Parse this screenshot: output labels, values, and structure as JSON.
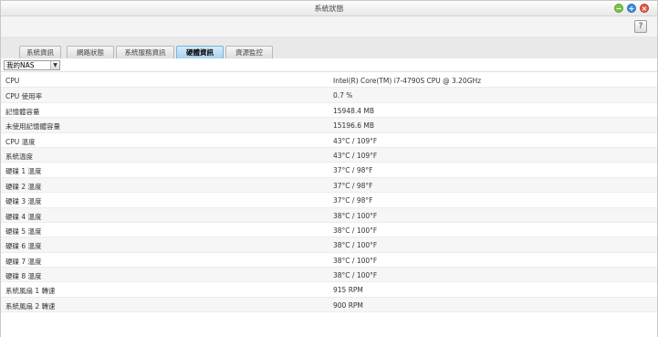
{
  "window": {
    "title": "系統狀態"
  },
  "tabs": [
    {
      "label": "系統資訊"
    },
    {
      "label": "網路狀態"
    },
    {
      "label": "系統服務資訊"
    },
    {
      "label": "硬體資訊",
      "active": true
    },
    {
      "label": "資源監控"
    }
  ],
  "help": {
    "label": "?"
  },
  "filter": {
    "selected": "我的NAS"
  },
  "rows": [
    {
      "key": "CPU",
      "value": "Intel(R) Core(TM) i7-4790S CPU @ 3.20GHz"
    },
    {
      "key": "CPU 使用率",
      "value": "0.7 %"
    },
    {
      "key": "記憶體容量",
      "value": "15948.4 MB"
    },
    {
      "key": "未使用記憶體容量",
      "value": "15196.6 MB"
    },
    {
      "key": "CPU 溫度",
      "value": "43°C / 109°F"
    },
    {
      "key": "系統溫度",
      "value": "43°C / 109°F"
    },
    {
      "key": "硬碟 1 溫度",
      "value": "37°C / 98°F"
    },
    {
      "key": "硬碟 2 溫度",
      "value": "37°C / 98°F"
    },
    {
      "key": "硬碟 3 溫度",
      "value": "37°C / 98°F"
    },
    {
      "key": "硬碟 4 溫度",
      "value": "38°C / 100°F"
    },
    {
      "key": "硬碟 5 溫度",
      "value": "38°C / 100°F"
    },
    {
      "key": "硬碟 6 溫度",
      "value": "38°C / 100°F"
    },
    {
      "key": "硬碟 7 溫度",
      "value": "38°C / 100°F"
    },
    {
      "key": "硬碟 8 溫度",
      "value": "38°C / 100°F"
    },
    {
      "key": "系統風扇 1 轉速",
      "value": "915 RPM"
    },
    {
      "key": "系統風扇 2 轉速",
      "value": "900 RPM"
    }
  ]
}
